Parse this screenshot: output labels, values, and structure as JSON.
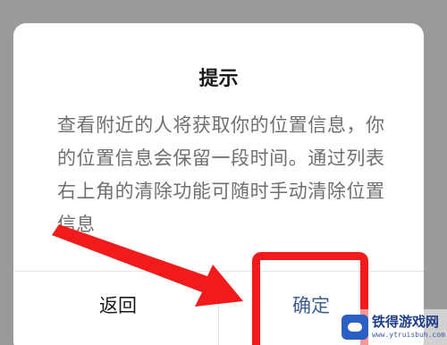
{
  "dialog": {
    "title": "提示",
    "message": "查看附近的人将获取你的位置信息，你的位置信息会保留一段时间。通过列表右上角的清除功能可随时手动清除位置信息",
    "buttons": {
      "back": "返回",
      "ok": "确定"
    }
  },
  "watermark": {
    "name": "铁得游戏网",
    "url": "www.ytruisbuh.com"
  },
  "colors": {
    "annotation": "#f21b1b",
    "confirm_text": "#3d5f94",
    "overlay": "#9a9a9a"
  }
}
